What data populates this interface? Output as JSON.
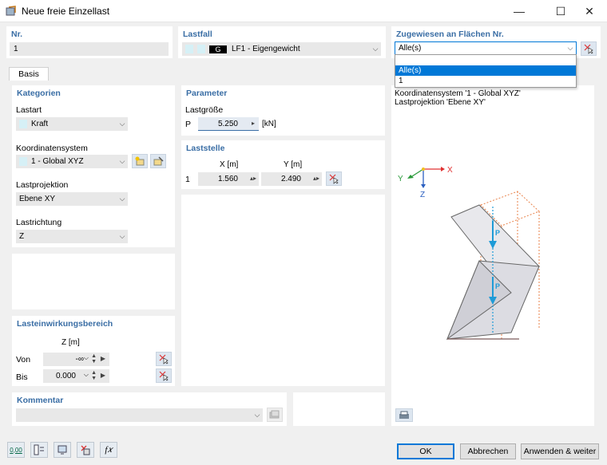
{
  "window": {
    "title": "Neue freie Einzellast",
    "minimize": "—",
    "maximize": "☐",
    "close": "✕"
  },
  "top": {
    "nr_label": "Nr.",
    "nr_value": "1",
    "lastfall_label": "Lastfall",
    "lastfall_code": "G",
    "lastfall_value": "LF1 - Eigengewicht",
    "zugewiesen_label": "Zugewiesen an Flächen Nr.",
    "zugewiesen_value": "Alle(s)"
  },
  "dropdown": {
    "options": [
      "Alle(s)",
      "1"
    ],
    "selected": "Alle(s)"
  },
  "tab": "Basis",
  "kategorien": {
    "title": "Kategorien",
    "lastart_label": "Lastart",
    "lastart_value": "Kraft",
    "koord_label": "Koordinatensystem",
    "koord_value": "1 - Global XYZ",
    "lastprojektion_label": "Lastprojektion",
    "lastprojektion_value": "Ebene XY",
    "lastrichtung_label": "Lastrichtung",
    "lastrichtung_value": "Z"
  },
  "parameter": {
    "title": "Parameter",
    "lastgroesse_label": "Lastgröße",
    "p_label": "P",
    "p_value": "5.250",
    "p_unit": "[kN]"
  },
  "laststelle": {
    "title": "Laststelle",
    "x_header": "X [m]",
    "y_header": "Y [m]",
    "row_no": "1",
    "x_value": "1.560",
    "y_value": "2.490"
  },
  "lasteinwirkung": {
    "title": "Lasteinwirkungsbereich",
    "z_header": "Z [m]",
    "von_label": "Von",
    "von_value": "-∞",
    "bis_label": "Bis",
    "bis_value": "0.000"
  },
  "kommentar": {
    "title": "Kommentar",
    "value": ""
  },
  "preview": {
    "line1": "Koordinatensystem '1 - Global XYZ'",
    "line2": "Lastprojektion 'Ebene XY'",
    "axis_x": "X",
    "axis_y": "Y",
    "axis_z": "Z",
    "load_label": "P"
  },
  "footer": {
    "ok": "OK",
    "cancel": "Abbrechen",
    "apply": "Anwenden & weiter",
    "units_icon": "0,00",
    "fx_icon": "f𝑥"
  },
  "colors": {
    "accent": "#3a6ea5",
    "load": "#1e9bd7",
    "select": "#0078d7",
    "dashed": "#e8824a"
  }
}
